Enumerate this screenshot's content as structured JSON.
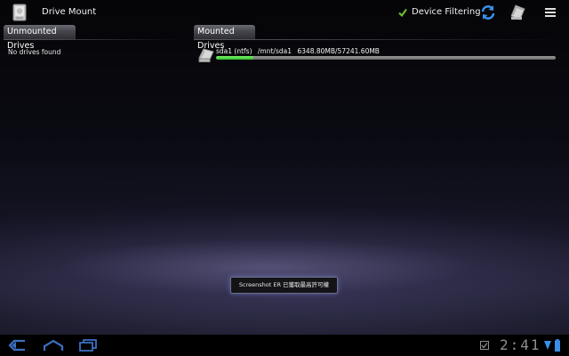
{
  "action_bar": {
    "title": "Drive Mount",
    "filter_label": "Device Filtering",
    "filter_checked": true
  },
  "unmounted": {
    "header": "Unmounted Drives",
    "empty_text": "No drives found"
  },
  "mounted": {
    "header": "Mounted Drives",
    "drives": [
      {
        "name": "sda1 (ntfs)",
        "path": "/mnt/sda1",
        "usage": "6348.80MB/57241.60MB",
        "used_fraction": 0.111
      }
    ]
  },
  "toast": {
    "text": "Screenshot ER 已獲取最高許可權"
  },
  "system_bar": {
    "clock": "2:41"
  },
  "colors": {
    "progress": "#3ccf30",
    "accent_blue": "#3a8fe8",
    "check_green": "#6ec531"
  }
}
